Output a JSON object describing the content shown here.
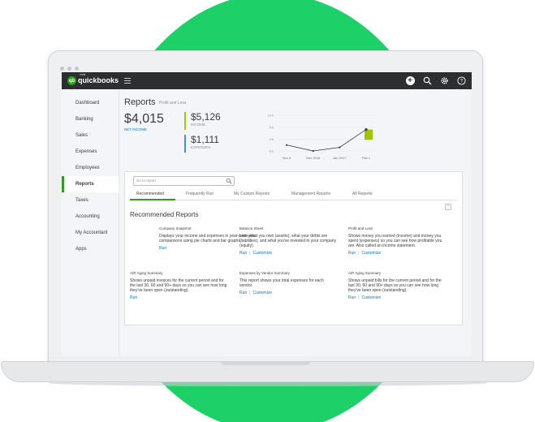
{
  "app": {
    "logo_text": "quickbooks",
    "logo_small": "intuit",
    "logo_mark": "qb",
    "brand_color": "#2ca01c",
    "topbar_icons": [
      "plus-icon",
      "search-icon",
      "gear-icon",
      "help-icon"
    ]
  },
  "sidebar": {
    "items": [
      {
        "label": "Dashboard"
      },
      {
        "label": "Banking"
      },
      {
        "label": "Sales"
      },
      {
        "label": "Expenses"
      },
      {
        "label": "Employees"
      },
      {
        "label": "Reports",
        "active": true
      },
      {
        "label": "Taxes"
      },
      {
        "label": "Accounting"
      },
      {
        "label": "My Accountant"
      },
      {
        "label": "Apps"
      }
    ]
  },
  "header": {
    "title": "Reports",
    "subtitle": "Profit and Loss"
  },
  "summary": {
    "net_income_value": "$4,015",
    "net_income_label": "NET INCOME",
    "income_value": "$5,126",
    "income_label": "INCOME",
    "expenses_value": "$1,111",
    "expenses_label": "EXPENSES",
    "income_color": "#9ec700",
    "expenses_color": "#4a90c2"
  },
  "chart_data": {
    "type": "line",
    "x": [
      "Nov 8",
      "Dec 2016",
      "Jan 2017",
      "Feb 1"
    ],
    "values": [
      -2.5,
      -5,
      -3.5,
      4
    ],
    "yticks": [
      "10 k",
      "5 k",
      "0 k",
      "-5 k"
    ],
    "ylim": [
      -5,
      10
    ],
    "highlight_color": "#9ec700"
  },
  "search": {
    "placeholder": "Go to report"
  },
  "tabs": [
    {
      "label": "Recommended",
      "active": true
    },
    {
      "label": "Frequently Run"
    },
    {
      "label": "My Custom Reports"
    },
    {
      "label": "Management Reports"
    },
    {
      "label": "All Reports"
    }
  ],
  "section": {
    "title": "Recommended Reports"
  },
  "reports": [
    {
      "name": "Company Snapshot",
      "desc": "Displays your income and expenses in year-over-year comparisons using pie charts and bar graphs.",
      "run": "Run"
    },
    {
      "name": "Balance Sheet",
      "desc": "Lists what you own (assets), what your debts are (liabilities), and what you've invested in your company (equity).",
      "run": "Run",
      "customize": "Customize"
    },
    {
      "name": "Profit and Loss",
      "desc": "Shows money you earned (income) and money you spent (expenses) so you can see how profitable you are. Also called an income statement.",
      "run": "Run",
      "customize": "Customize"
    },
    {
      "name": "A/R Aging Summary",
      "desc": "Shows unpaid invoices for the current period and for the last 30, 60 and 90+ days so you can see how long they've been open (outstanding).",
      "run": "Run"
    },
    {
      "name": "Expenses by Vendor Summary",
      "desc": "This report shows your total expenses for each vendor.",
      "run": "Run",
      "customize": "Customize"
    },
    {
      "name": "A/P Aging Summary",
      "desc": "Shows unpaid bills for the current period and for the last 30, 60 and 90+ days so you can see how long they've been open (outstanding).",
      "run": "Run",
      "customize": "Customize"
    }
  ],
  "links": {
    "separator": "|"
  }
}
